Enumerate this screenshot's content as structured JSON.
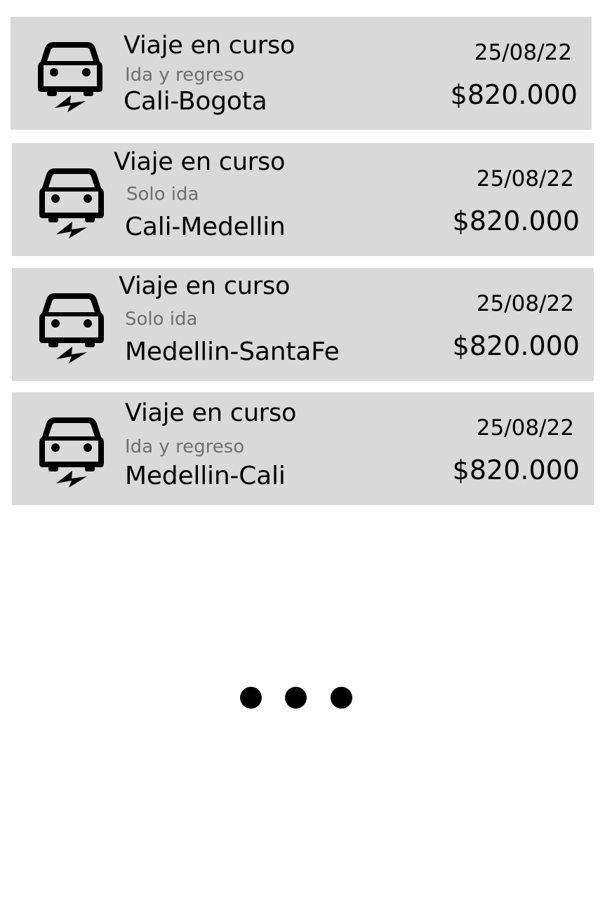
{
  "trips": [
    {
      "status": "Viaje en curso",
      "trip_type": "Ida y regreso",
      "route": "Cali-Bogota",
      "date": "25/08/22",
      "price": "$820.000",
      "icon": "electric-car-icon"
    },
    {
      "status": "Viaje en curso",
      "trip_type": "Solo ida",
      "route": "Cali-Medellin",
      "date": "25/08/22",
      "price": "$820.000",
      "icon": "electric-car-icon"
    },
    {
      "status": "Viaje en curso",
      "trip_type": "Solo ida",
      "route": "Medellin-SantaFe",
      "date": "25/08/22",
      "price": "$820.000",
      "icon": "electric-car-icon"
    },
    {
      "status": "Viaje en curso",
      "trip_type": "Ida y regreso",
      "route": "Medellin-Cali",
      "date": "25/08/22",
      "price": "$820.000",
      "icon": "electric-car-icon"
    }
  ],
  "more_indicator": {
    "icon": "more-dots-icon"
  },
  "colors": {
    "card_background": "#d9d9d9",
    "secondary_text": "#6f6f6f",
    "primary_text": "#000000"
  }
}
